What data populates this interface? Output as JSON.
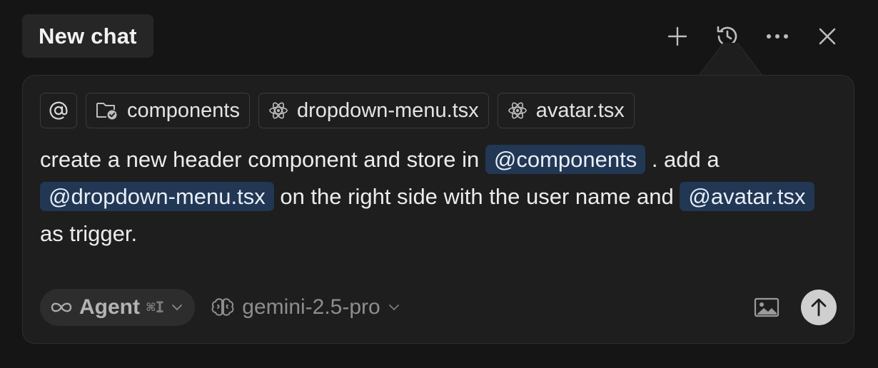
{
  "header": {
    "title": "New chat",
    "icons": [
      "plus-icon",
      "history-icon",
      "more-icon",
      "close-icon"
    ]
  },
  "composer": {
    "chips": [
      {
        "icon": "at-sign-icon",
        "label": ""
      },
      {
        "icon": "folder-check-icon",
        "label": "components"
      },
      {
        "icon": "react-icon",
        "label": "dropdown-menu.tsx"
      },
      {
        "icon": "react-icon",
        "label": "avatar.tsx"
      }
    ],
    "prompt": {
      "seg1": "create a new header component and store in ",
      "mention1": "@components",
      "seg2": " .  add a ",
      "mention2": "@dropdown-menu.tsx",
      "seg3": " on the right side with the user name and ",
      "mention3": "@avatar.tsx",
      "seg4": " as trigger."
    },
    "footer": {
      "mode_icon": "infinity-icon",
      "mode_label": "Agent",
      "mode_shortcut": "⌘I",
      "model_icon": "brain-icon",
      "model_label": "gemini-2.5-pro",
      "image_icon": "image-icon",
      "send_icon": "arrow-up-icon"
    }
  },
  "colors": {
    "background": "#151515",
    "panel": "#1e1e1e",
    "mention_bg": "#213754",
    "send_button": "#cfcfcf"
  }
}
